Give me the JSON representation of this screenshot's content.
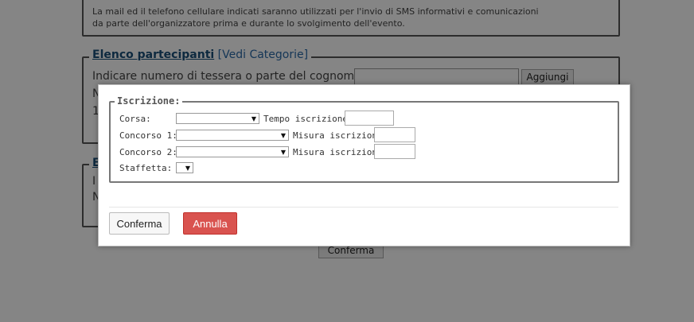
{
  "background": {
    "info_text_line1": "La mail ed il telefono cellulare indicati saranno utilizzati per l'invio di SMS informativi e comunicazioni",
    "info_text_line2": "da parte dell'organizzatore prima e durante lo svolgimento dell'evento.",
    "participants_title": "Elenco partecipanti",
    "participants_categories_link": "[Vedi Categorie]",
    "search_label": "Indicare numero di tessera o parte del cognome:",
    "add_button": "Aggiungi",
    "confirm_button": "Conferma",
    "partial_chars": [
      "N",
      "1",
      "E",
      "I",
      "N"
    ]
  },
  "modal": {
    "legend": "Iscrizione:",
    "fields": {
      "corsa_label": "Corsa:",
      "tempo_label": "Tempo iscrizione:",
      "concorso1_label": "Concorso 1:",
      "misura1_label": "Misura iscrizione:",
      "concorso2_label": "Concorso 2:",
      "misura2_label": "Misura iscrizione:",
      "staffetta_label": "Staffetta:"
    },
    "confirm_button": "Conferma",
    "cancel_button": "Annulla",
    "colors": {
      "cancel_bg": "#d9534f",
      "overlay": "rgba(0,0,0,0.48)",
      "link": "#2b6aa8"
    }
  }
}
